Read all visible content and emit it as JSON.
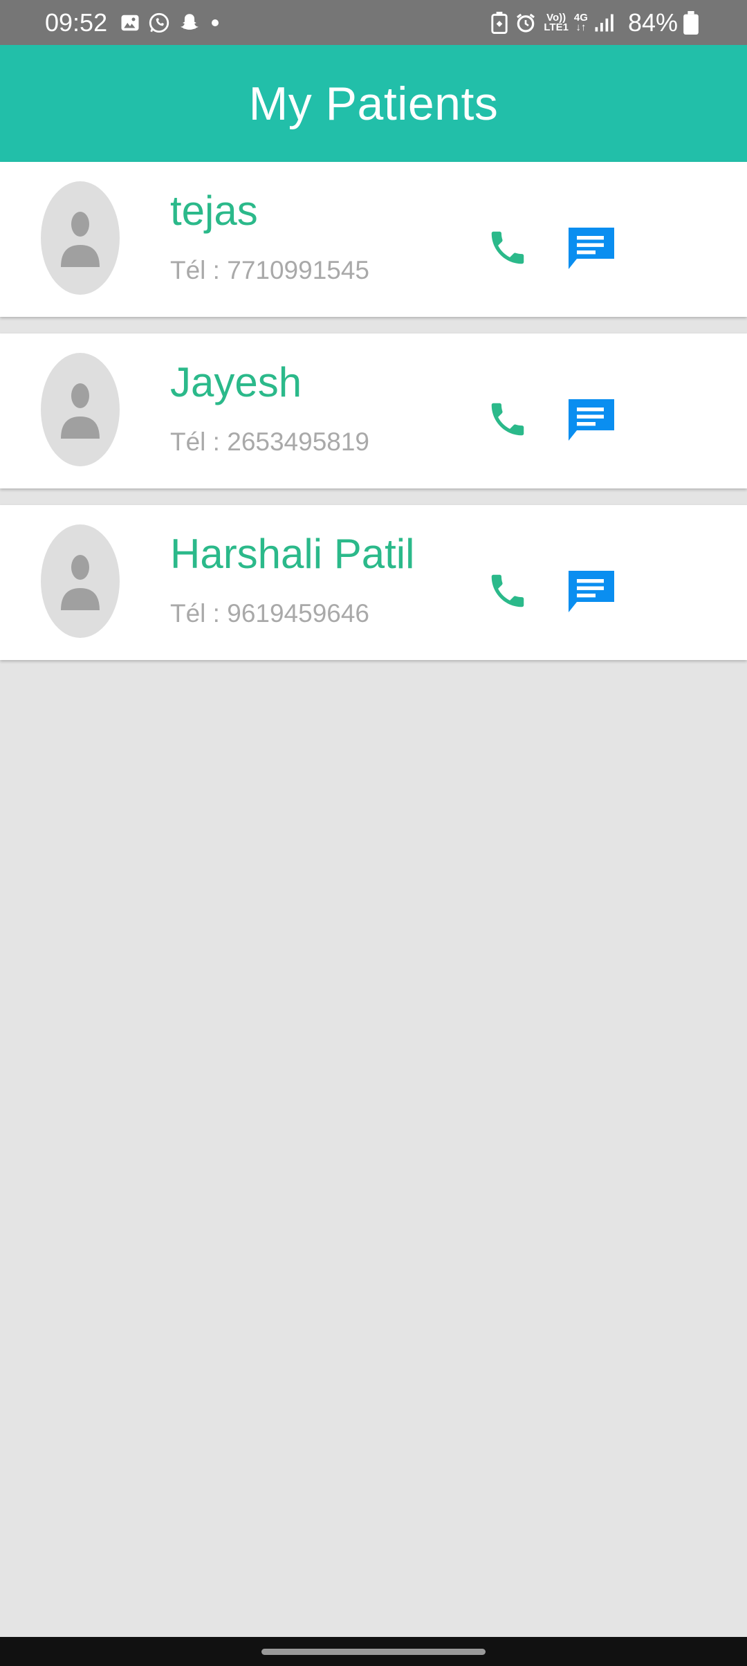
{
  "status_bar": {
    "time": "09:52",
    "network_top": "Vo))",
    "network_bottom": "LTE1",
    "data_type": "4G",
    "battery": "84%",
    "icons": [
      "gallery-icon",
      "whatsapp-icon",
      "snapchat-icon",
      "dot-icon",
      "battery-saver-icon",
      "alarm-icon",
      "signal-icon",
      "battery-icon"
    ]
  },
  "app_bar": {
    "title": "My Patients"
  },
  "patients": [
    {
      "name": "tejas",
      "phone": "Tél : 7710991545"
    },
    {
      "name": "Jayesh",
      "phone": "Tél : 2653495819"
    },
    {
      "name": "Harshali Patil",
      "phone": "Tél : 9619459646"
    }
  ],
  "colors": {
    "app_bar": "#22bfa9",
    "name": "#2bb98a",
    "call_icon": "#2bb98a",
    "message_icon": "#0a8ef0",
    "phone_text": "#a9a9a9",
    "background": "#e4e4e4"
  }
}
